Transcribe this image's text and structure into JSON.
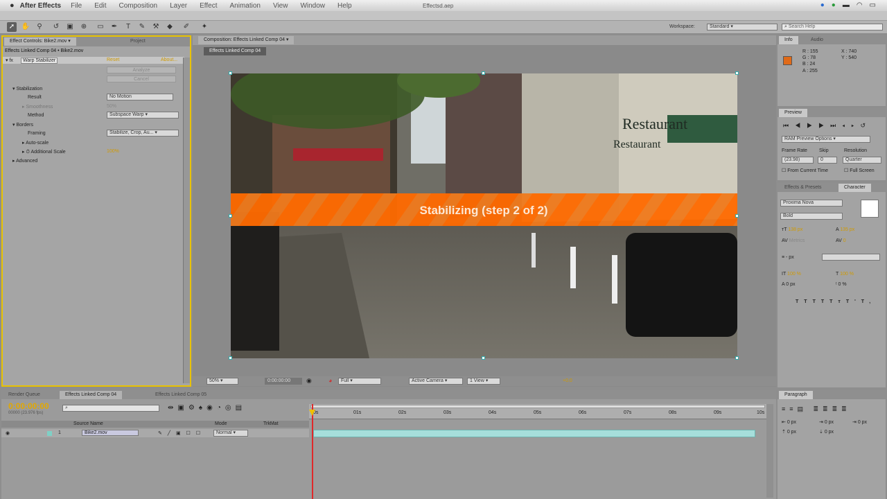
{
  "menubar": {
    "app": "After Effects",
    "items": [
      "File",
      "Edit",
      "Composition",
      "Layer",
      "Effect",
      "Animation",
      "View",
      "Window",
      "Help"
    ],
    "document": "Effectsd.aep"
  },
  "workspace": {
    "label": "Workspace:",
    "value": "Standard",
    "search_placeholder": "Search Help"
  },
  "effect_controls": {
    "tab": "Effect Controls: Bike2.mov",
    "tab2": "Project",
    "header": "Effects Linked Comp 04 • Bike2.mov",
    "effect_name": "Warp Stabilizer",
    "reset": "Reset",
    "about": "About...",
    "analyze": "Analyze",
    "cancel": "Cancel",
    "stabilization": "Stabilization",
    "result_label": "Result",
    "result_value": "No Motion",
    "smoothness_label": "Smoothness",
    "smoothness_value": "50%",
    "method_label": "Method",
    "method_value": "Subspace Warp",
    "borders": "Borders",
    "framing_label": "Framing",
    "framing_value": "Stabilize, Crop, Au...",
    "autoscale": "Auto-scale",
    "additional_scale_label": "Additional Scale",
    "additional_scale_value": "100%",
    "advanced": "Advanced"
  },
  "composition": {
    "tab": "Composition: Effects Linked Comp 04",
    "sub_tab": "Effects Linked Comp 04",
    "banner_text": "Stabilizing (step 2 of 2)",
    "zoom": "50%",
    "timecode": "0:00:00:00",
    "resolution": "Full",
    "camera": "Active Camera",
    "view": "1 View",
    "exposure": "+0.0"
  },
  "scene": {
    "sign1": "Restaurant",
    "sign2": "Restaurant"
  },
  "info": {
    "tab": "Info",
    "tab2": "Audio",
    "r": "R : 155",
    "g": "G : 78",
    "b": "B : 24",
    "a": "A : 255",
    "x": "X : 740",
    "y": "Y : 540",
    "swatch": "#e06a18"
  },
  "preview": {
    "tab": "Preview",
    "ram": "RAM Preview Options",
    "frame_rate_label": "Frame Rate",
    "skip_label": "Skip",
    "resolution_label": "Resolution",
    "frame_rate_value": "(23.98)",
    "skip_value": "0",
    "resolution_value": "Quarter",
    "from_current": "From Current Time",
    "full_screen": "Full Screen"
  },
  "character": {
    "tab": "Effects & Presets",
    "tab2": "Character",
    "font": "Proxima Nova",
    "style": "Bold",
    "size": "138 px",
    "leading": "135 px",
    "kerning": "Metrics",
    "tracking": "0",
    "stroke": "- px",
    "vscale": "100 %",
    "hscale": "100 %",
    "baseline": "0 px",
    "tsume": "0 %",
    "styles": [
      "T",
      "T",
      "TT",
      "Tт",
      "T'",
      "T,"
    ]
  },
  "paragraph": {
    "tab": "Paragraph",
    "indent1": "0 px",
    "indent2": "0 px",
    "indent3": "0 px",
    "space1": "0 px",
    "space2": "0 px"
  },
  "timeline": {
    "tab1": "Render Queue",
    "tab2": "Effects Linked Comp 04",
    "tab3": "Effects Linked Comp 05",
    "timecode": "0:00:00:00",
    "fps": "00000 (23.976 fps)",
    "col_source": "Source Name",
    "col_mode": "Mode",
    "col_trkmat": "TrkMat",
    "layer_num": "1",
    "layer_name": "Bike2.mov",
    "layer_mode": "Normal",
    "ruler": [
      "0s",
      "01s",
      "02s",
      "03s",
      "04s",
      "05s",
      "06s",
      "07s",
      "08s",
      "09s",
      "10s"
    ]
  }
}
